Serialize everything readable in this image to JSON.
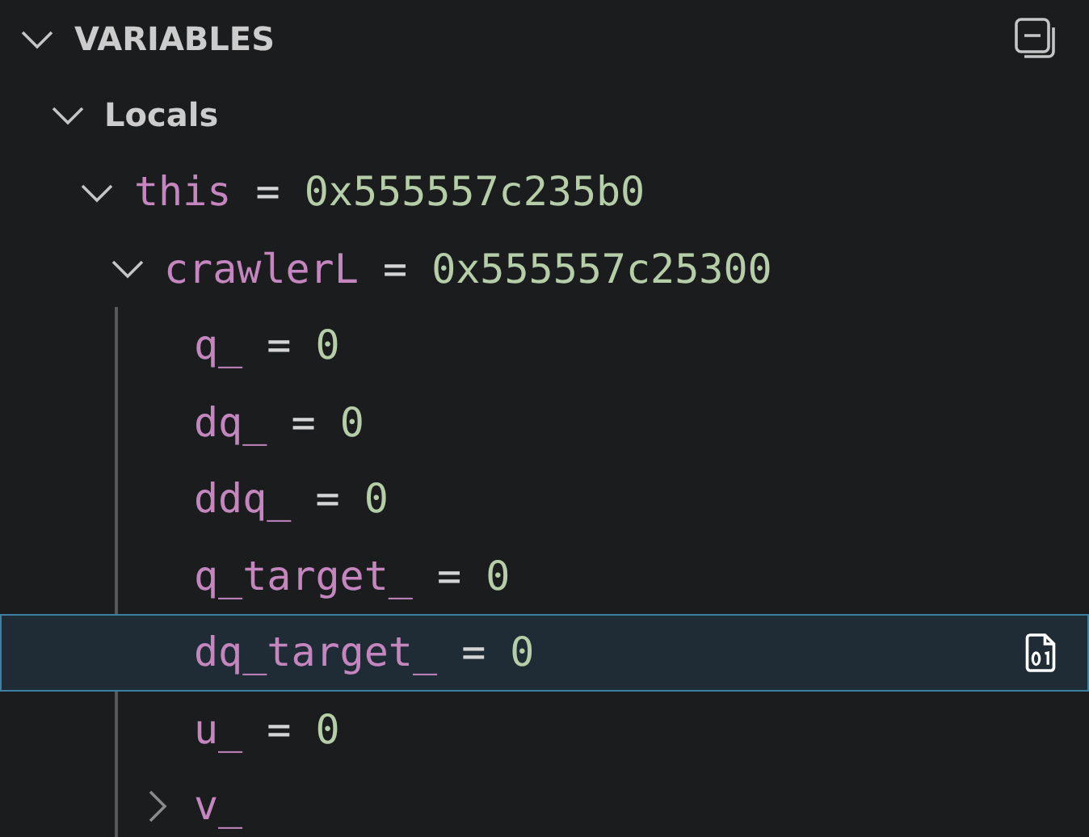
{
  "section": {
    "title": "VARIABLES",
    "expanded": true
  },
  "scopes": [
    {
      "name": "Locals",
      "expanded": true,
      "children": [
        {
          "name": "this",
          "separator": "=",
          "value": "0x555557c235b0",
          "expanded": true,
          "selected": false,
          "children": [
            {
              "name": "crawlerL",
              "separator": "=",
              "value": "0x555557c25300",
              "expanded": true,
              "selected": false,
              "children": [
                {
                  "name": "q_",
                  "separator": "=",
                  "value": "0",
                  "selected": false
                },
                {
                  "name": "dq_",
                  "separator": "=",
                  "value": "0",
                  "selected": false
                },
                {
                  "name": "ddq_",
                  "separator": "=",
                  "value": "0",
                  "selected": false
                },
                {
                  "name": "q_target_",
                  "separator": "=",
                  "value": "0",
                  "selected": false
                },
                {
                  "name": "dq_target_",
                  "separator": "=",
                  "value": "0",
                  "selected": true
                },
                {
                  "name": "u_",
                  "separator": "=",
                  "value": "0",
                  "selected": false
                },
                {
                  "name": "v_",
                  "expanded": false,
                  "selected": false
                }
              ]
            }
          ]
        }
      ]
    }
  ]
}
